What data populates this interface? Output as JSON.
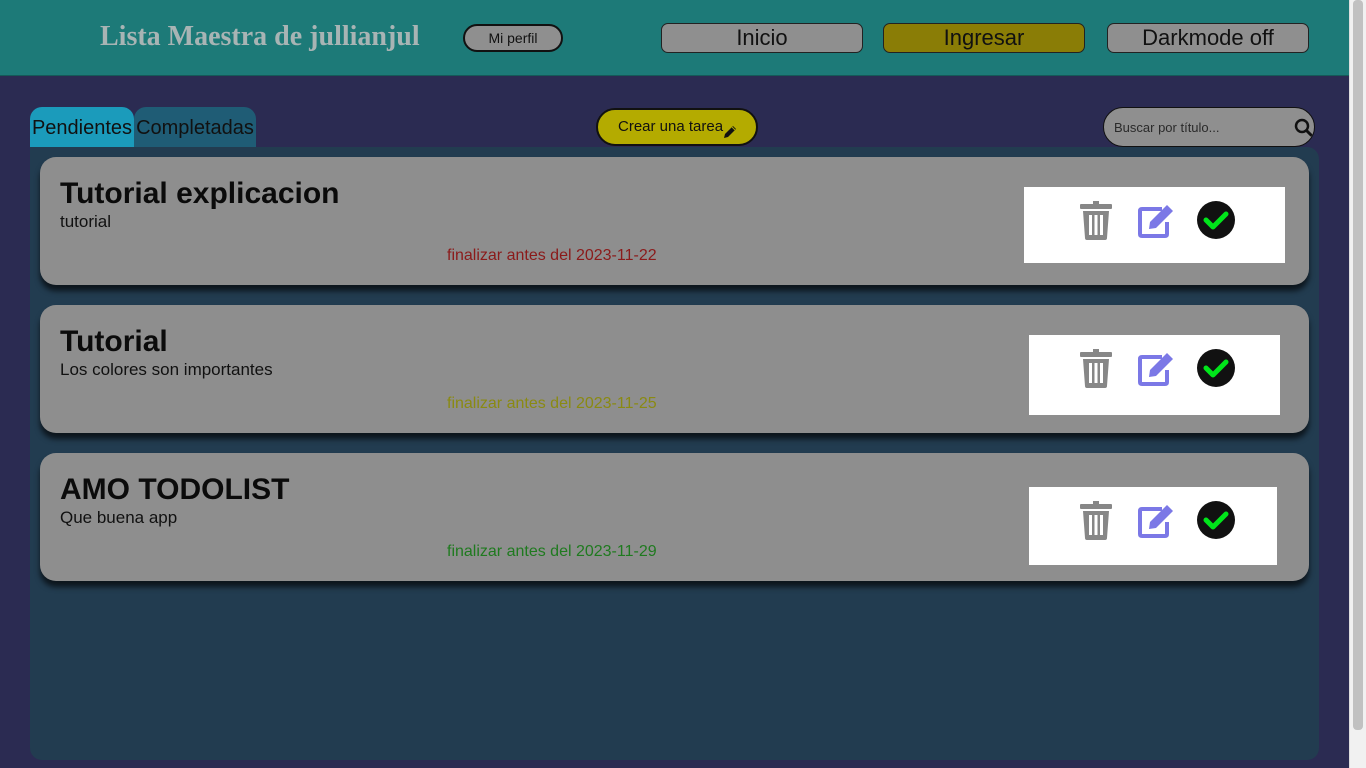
{
  "header": {
    "title": "Lista Maestra de jullianjul",
    "profile_label": "Mi perfil",
    "nav": {
      "home_label": "Inicio",
      "login_label": "Ingresar",
      "darkmode_label": "Darkmode off"
    }
  },
  "toolbar": {
    "tabs": [
      {
        "label": "Pendientes",
        "selected": true
      },
      {
        "label": "Completadas",
        "selected": false
      }
    ],
    "create_label": "Crear una tarea",
    "search_placeholder": "Buscar por título..."
  },
  "tasks": [
    {
      "title": "Tutorial explicacion",
      "description": "tutorial",
      "due": "finalizar antes del 2023-11-22",
      "due_color": "#8b1a1a"
    },
    {
      "title": "Tutorial",
      "description": "Los colores son importantes",
      "due": "finalizar antes del 2023-11-25",
      "due_color": "#8a8a12"
    },
    {
      "title": "AMO TODOLIST",
      "description": "Que buena app",
      "due": "finalizar antes del 2023-11-29",
      "due_color": "#1f7a1f"
    }
  ],
  "icons": {
    "delete": "trash-icon",
    "edit": "edit-icon",
    "complete": "check-circle-icon"
  },
  "colors": {
    "header": "#1d7a78",
    "background": "#2b2b52",
    "panel": "#223c50",
    "active_nav": "#8a7d06",
    "create_button": "#b4ab00",
    "edit_icon": "#7b78e6",
    "check_icon": "#00e61a"
  }
}
